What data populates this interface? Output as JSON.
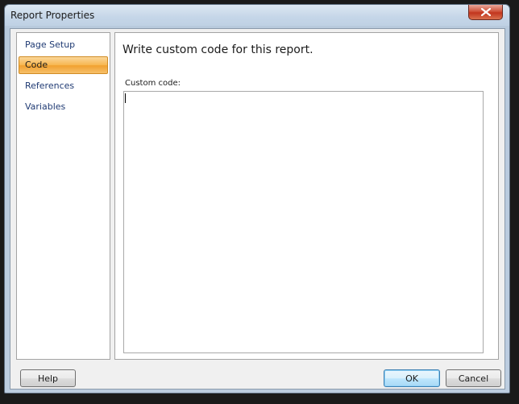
{
  "window": {
    "title": "Report Properties"
  },
  "titlebar": {
    "close_icon": "close-x-icon"
  },
  "nav": {
    "items": [
      {
        "label": "Page Setup",
        "selected": false
      },
      {
        "label": "Code",
        "selected": true
      },
      {
        "label": "References",
        "selected": false
      },
      {
        "label": "Variables",
        "selected": false
      }
    ]
  },
  "content": {
    "heading": "Write custom code for this report.",
    "field_label": "Custom code:",
    "field_value": ""
  },
  "footer": {
    "help_label": "Help",
    "ok_label": "OK",
    "cancel_label": "Cancel"
  },
  "colors": {
    "selected_accent": "#f7b64f",
    "nav_text": "#1f3a73",
    "close_button": "#c2361e"
  }
}
